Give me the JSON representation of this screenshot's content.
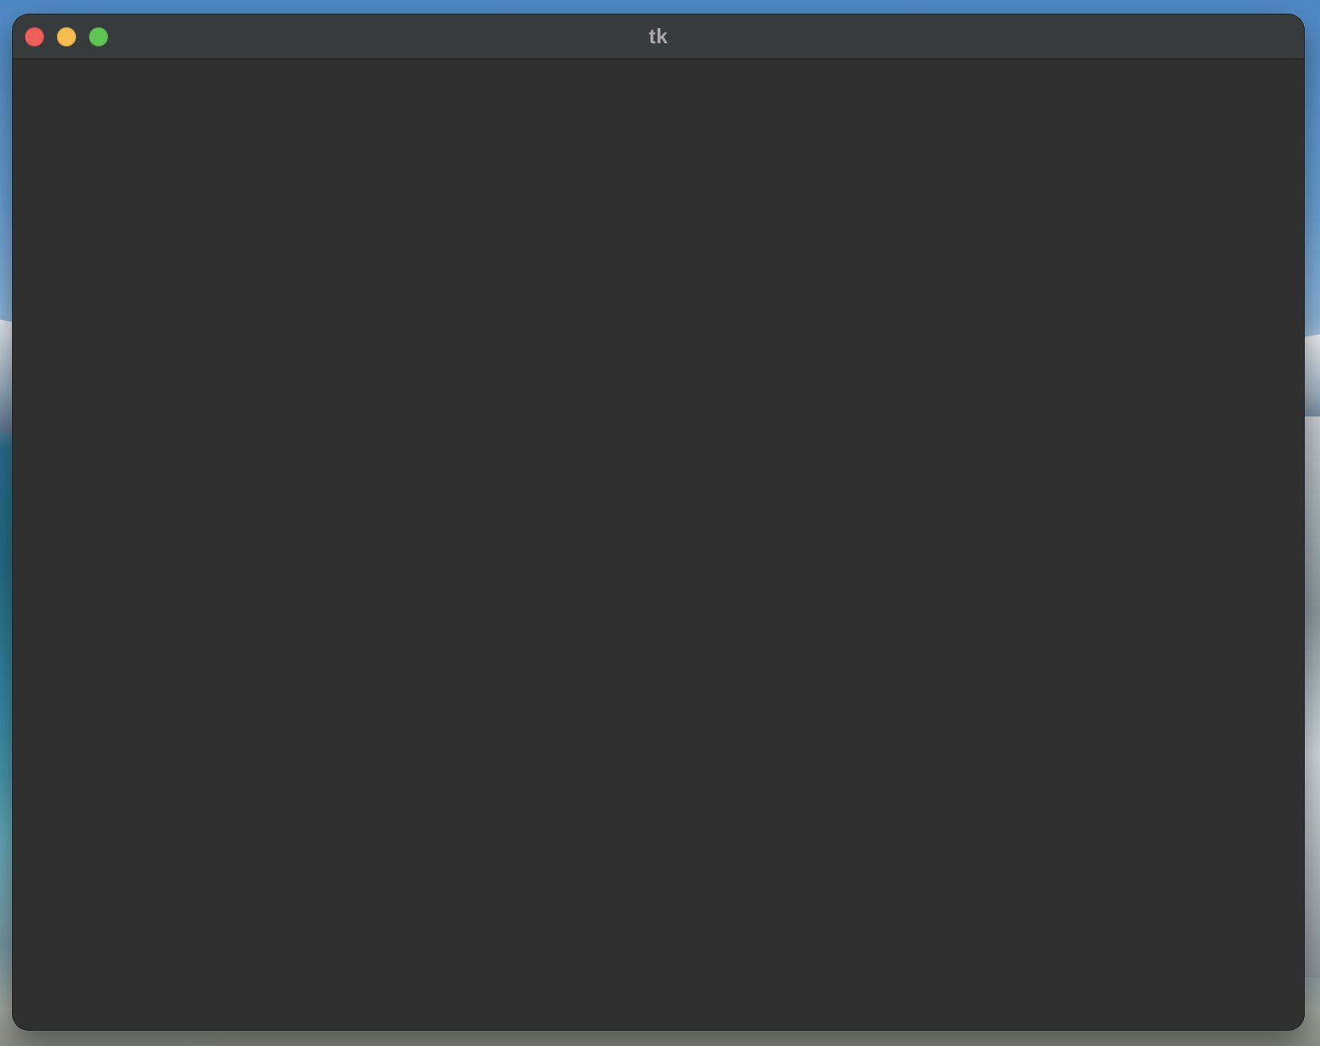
{
  "window": {
    "title": "tk",
    "content_color": "#313131",
    "titlebar_color": "#383b3c",
    "title_color": "#a9a9a9"
  },
  "traffic_lights": {
    "close": {
      "name": "close-icon",
      "color": "#ee5f57"
    },
    "minimize": {
      "name": "minimize-icon",
      "color": "#f5bd4f"
    },
    "maximize": {
      "name": "maximize-icon",
      "color": "#5fc554"
    }
  }
}
